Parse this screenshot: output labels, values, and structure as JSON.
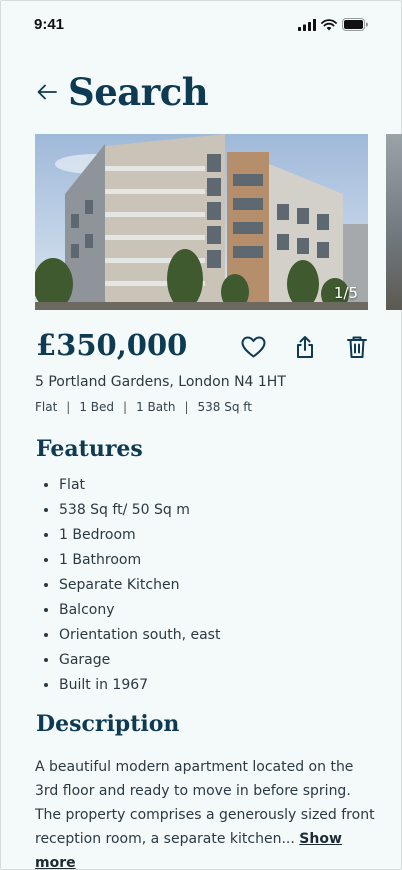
{
  "status_bar": {
    "time": "9:41"
  },
  "header": {
    "title": "Search"
  },
  "gallery": {
    "counter": "1/5"
  },
  "listing": {
    "price": "£350,000",
    "address": "5 Portland Gardens, London N4 1HT",
    "specs": [
      "Flat",
      "1 Bed",
      "1 Bath",
      "538 Sq ft"
    ]
  },
  "features": {
    "title": "Features",
    "items": [
      "Flat",
      "538 Sq ft/ 50 Sq m",
      "1 Bedroom",
      "1 Bathroom",
      "Separate Kitchen",
      "Balcony",
      "Orientation south, east",
      "Garage",
      "Built in 1967"
    ]
  },
  "description": {
    "title": "Description",
    "text": "A beautiful modern apartment located on the 3rd floor and ready to move in before spring. The property comprises a generously sized front reception room, a separate kitchen... ",
    "show_more": "Show more"
  },
  "colors": {
    "accent": "#0e3a52",
    "background": "#f4f9f9",
    "text": "#2b3a42"
  },
  "icons": [
    "back-arrow-icon",
    "heart-icon",
    "share-icon",
    "trash-icon",
    "signal-icon",
    "wifi-icon",
    "battery-icon"
  ]
}
